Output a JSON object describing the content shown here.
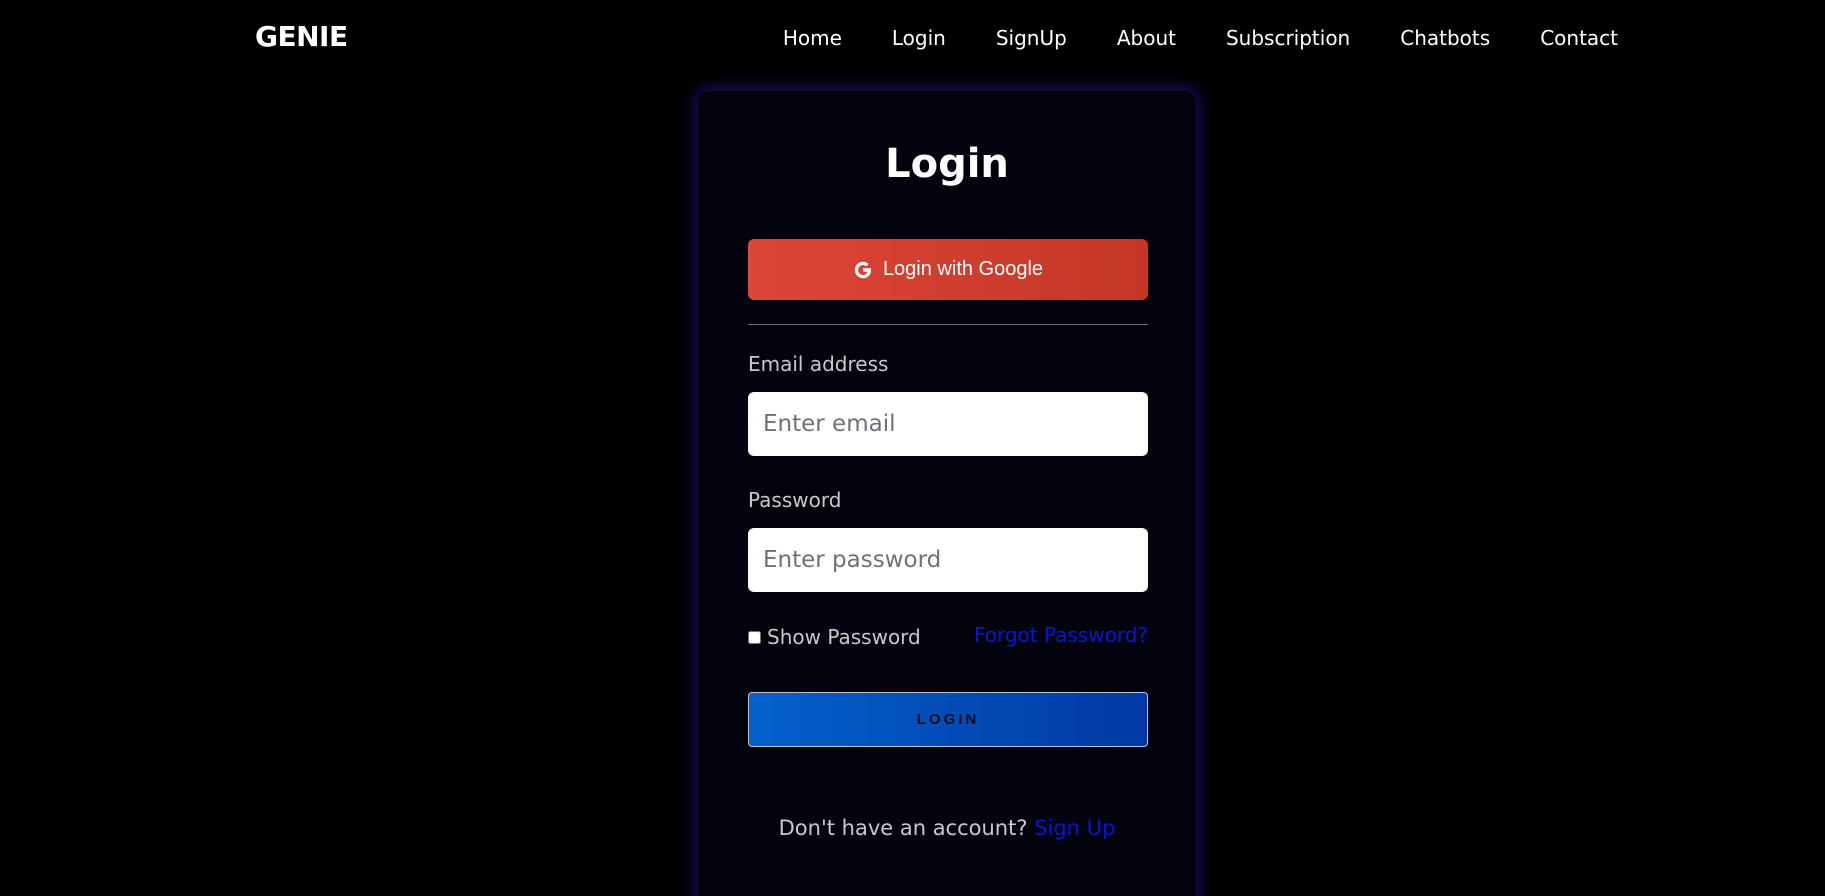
{
  "brand": "GENIE",
  "nav": {
    "items": [
      {
        "label": "Home"
      },
      {
        "label": "Login"
      },
      {
        "label": "SignUp"
      },
      {
        "label": "About"
      },
      {
        "label": "Subscription"
      },
      {
        "label": "Chatbots"
      },
      {
        "label": "Contact"
      }
    ]
  },
  "login_card": {
    "title": "Login",
    "google_button": {
      "label": "Login with Google",
      "icon": "google-g-icon",
      "color": "#d9443a"
    },
    "email": {
      "label": "Email address",
      "placeholder": "Enter email",
      "value": ""
    },
    "password": {
      "label": "Password",
      "placeholder": "Enter password",
      "value": ""
    },
    "show_password": {
      "label": "Show Password",
      "checked": false
    },
    "forgot_password": "Forgot Password?",
    "login_button": "LOGIN",
    "signup_prompt": "Don't have an account?",
    "signup_link": "Sign Up"
  },
  "colors": {
    "background": "#000000",
    "card": "#03030d",
    "card_glow": "#2814a0",
    "link": "#0a14d8",
    "login_button": "#0461cc"
  }
}
